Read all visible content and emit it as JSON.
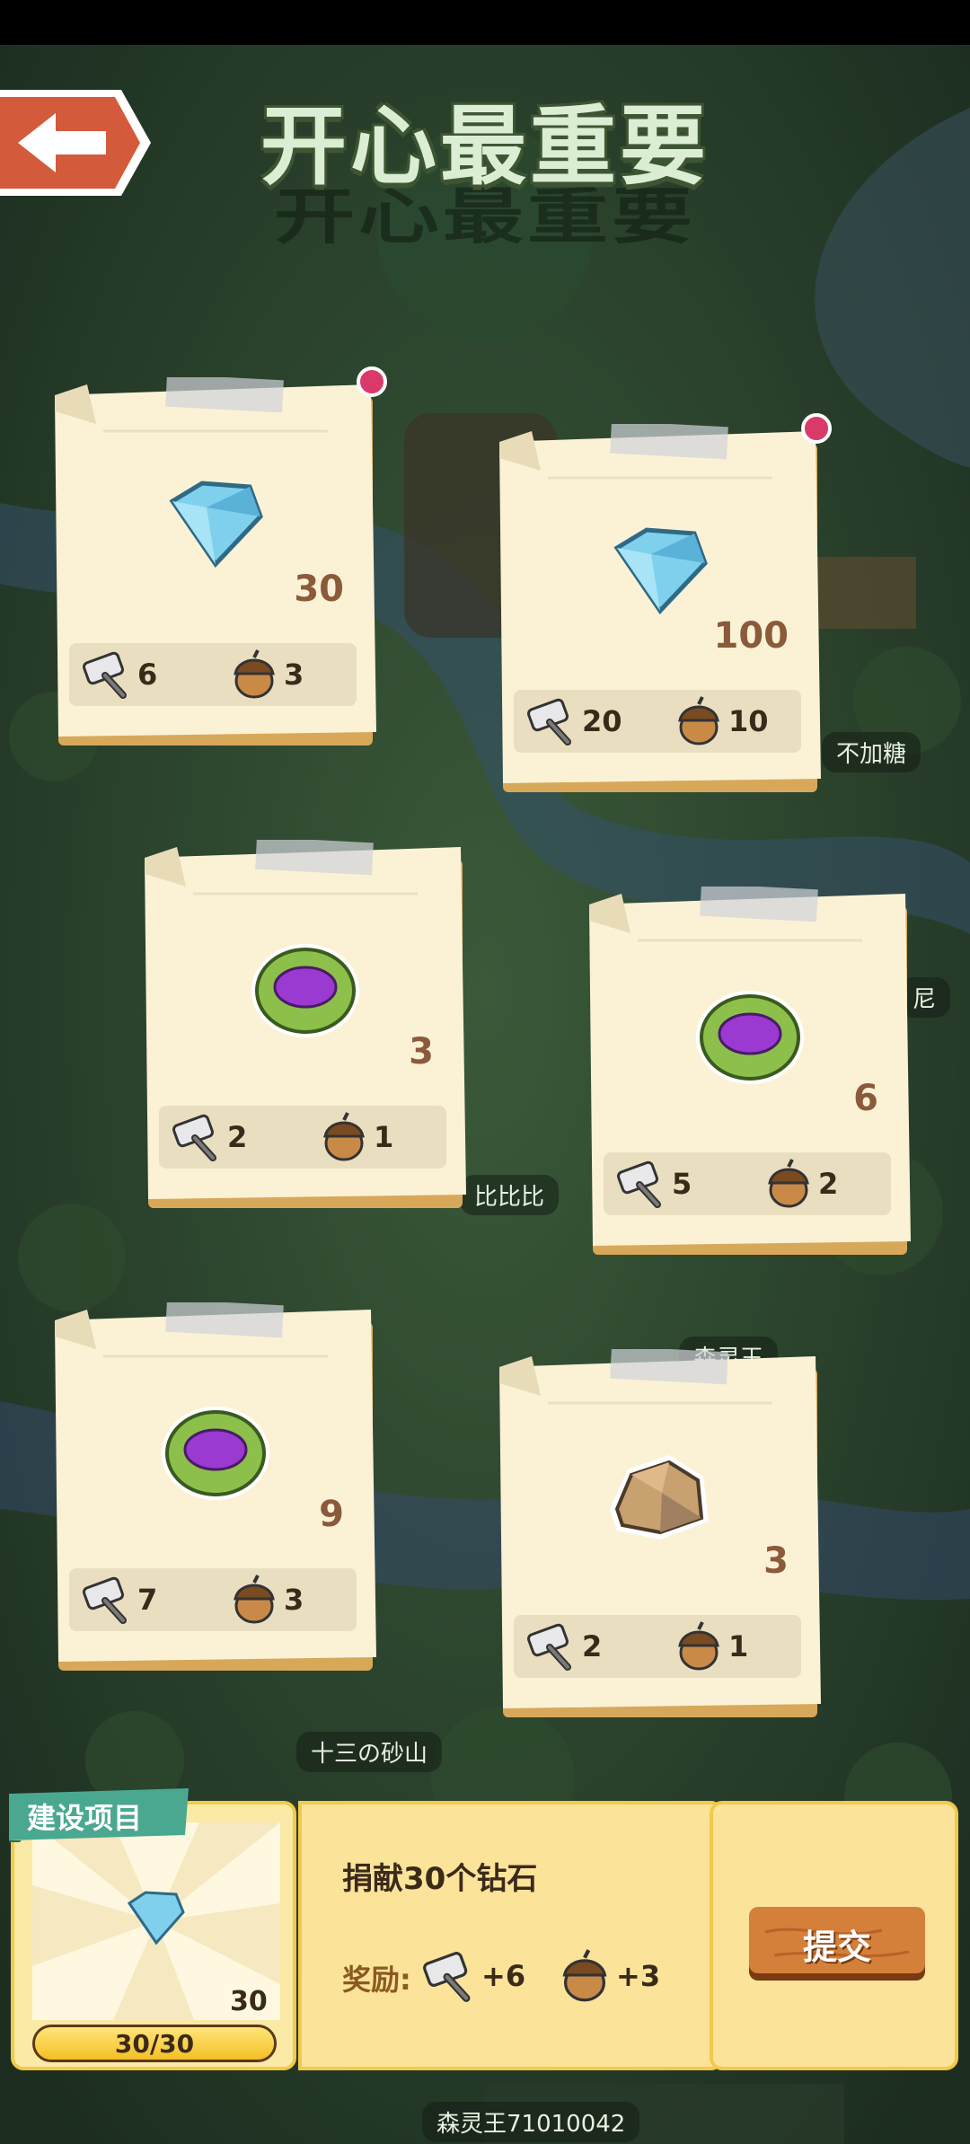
{
  "page": {
    "title": "开心最重要"
  },
  "map_labels": [
    "不加糖",
    "尼",
    "比比比",
    "森灵王",
    "十三の砂山",
    "森灵王71010042"
  ],
  "cards": [
    {
      "item": "diamond",
      "amount": "30",
      "hammer": "6",
      "acorn": "3",
      "notification": true
    },
    {
      "item": "diamond",
      "amount": "100",
      "hammer": "20",
      "acorn": "10",
      "notification": true
    },
    {
      "item": "purple-seed",
      "amount": "3",
      "hammer": "2",
      "acorn": "1",
      "notification": false
    },
    {
      "item": "purple-seed",
      "amount": "6",
      "hammer": "5",
      "acorn": "2",
      "notification": false
    },
    {
      "item": "purple-seed",
      "amount": "9",
      "hammer": "7",
      "acorn": "3",
      "notification": false
    },
    {
      "item": "stone",
      "amount": "3",
      "hammer": "2",
      "acorn": "1",
      "notification": false
    }
  ],
  "project": {
    "tag": "建设项目",
    "preview_amount": "30",
    "progress_text": "30/30",
    "progress_value": 1.0,
    "task": "捐献30个钻石",
    "reward_label": "奖励:",
    "reward_hammer": "+6",
    "reward_acorn": "+3",
    "submit_label": "提交"
  },
  "colors": {
    "panel_border": "#f3c94a",
    "notification": "#d93a6a",
    "paper": "#fbf2d6",
    "submit": "#c86a2a"
  }
}
